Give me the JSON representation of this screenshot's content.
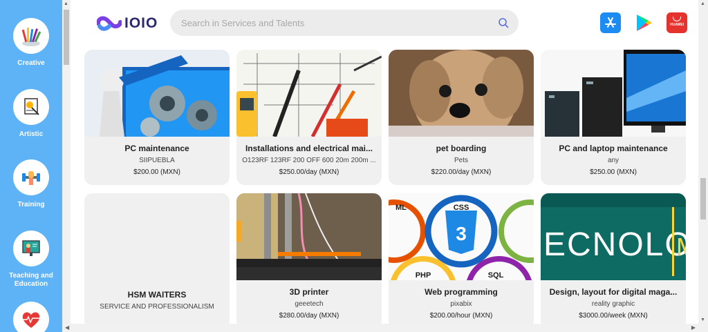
{
  "sidebar": {
    "categories": [
      {
        "label": "Creative",
        "icon": "paintbrushes-icon"
      },
      {
        "label": "Artistic",
        "icon": "easel-painting-icon"
      },
      {
        "label": "Training",
        "icon": "dumbbell-icon"
      },
      {
        "label": "Teaching and Education",
        "icon": "teacher-board-icon"
      },
      {
        "label": "",
        "icon": "heart-pulse-icon"
      }
    ]
  },
  "header": {
    "logo_text": "IOIO",
    "search_placeholder": "Search in Services and Talents",
    "stores": [
      "app-store-icon",
      "google-play-icon",
      "huawei-appgallery-icon"
    ],
    "huawei_label": "HUAWEI"
  },
  "listings": [
    {
      "title": "PC maintenance",
      "subtitle": "SIIPUEBLA",
      "price": "$200.00 (MXN)",
      "image": "pc-maintenance-gears-image"
    },
    {
      "title": "Installations and electrical mai...",
      "subtitle": "O123RF 123RF 200 OFF 600 20m 200m ...",
      "price": "$250.00/day (MXN)",
      "image": "electrical-tools-blueprint-image"
    },
    {
      "title": "pet boarding",
      "subtitle": "Pets",
      "price": "$220.00/day (MXN)",
      "image": "dog-photo-image"
    },
    {
      "title": "PC and laptop maintenance",
      "subtitle": "any",
      "price": "$250.00 (MXN)",
      "image": "desktop-computers-image"
    },
    {
      "title": "HSM WAITERS",
      "subtitle": "SERVICE AND PROFESSIONALISM",
      "price": "",
      "image": ""
    },
    {
      "title": "3D printer",
      "subtitle": "geeetech",
      "price": "$280.00/day (MXN)",
      "image": "3d-printer-photo-image"
    },
    {
      "title": "Web programming",
      "subtitle": "pixabix",
      "price": "$200.00/hour (MXN)",
      "image": "web-languages-logos-image"
    },
    {
      "title": "Design, layout for digital maga...",
      "subtitle": "reality graphic",
      "price": "$3000.00/week (MXN)",
      "image": "tecnologia-text-image"
    }
  ],
  "image_text": {
    "css": "CSS",
    "ml": "ML",
    "php": "PHP",
    "sql": "SQL",
    "tecnologia": "ECNOLOGIA",
    "m": "M"
  },
  "colors": {
    "sidebar": "#5eb3f7",
    "card": "#f0f0f0",
    "brand": "#2a2a6c"
  }
}
